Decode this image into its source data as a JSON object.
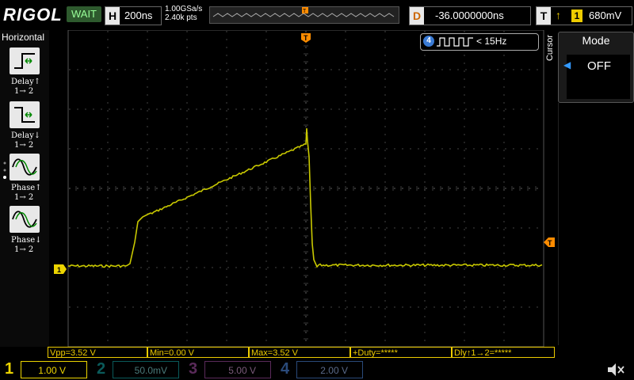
{
  "brand": "RIGOL",
  "status": "WAIT",
  "timebase": {
    "label": "H",
    "value": "200ns"
  },
  "sample": {
    "rate": "1.00GSa/s",
    "points": "2.40k pts"
  },
  "delay": {
    "label": "D",
    "value": "-36.0000000ns"
  },
  "trigger": {
    "label": "T",
    "edge": "↑",
    "source": "1",
    "level": "680mV"
  },
  "horizontal_menu": {
    "title": "Horizontal",
    "items": [
      {
        "label": "Delay↑",
        "sub": "1→ 2"
      },
      {
        "label": "Delay↓",
        "sub": "1→ 2"
      },
      {
        "label": "Phase↑",
        "sub": "1→ 2"
      },
      {
        "label": "Phase↓",
        "sub": "1→ 2"
      }
    ]
  },
  "freq_badge": {
    "channel": "4",
    "text": "< 15Hz"
  },
  "cursor_menu": {
    "tab": "Cursor",
    "title": "Mode",
    "value": "OFF"
  },
  "trigger_marker": "T",
  "ch1_marker": "1",
  "measurements": [
    {
      "text": "Vpp=3.52 V"
    },
    {
      "text": "Min=0.00 V"
    },
    {
      "text": "Max=3.52 V"
    },
    {
      "text": "+Duty=*****"
    },
    {
      "text": "Dly↑1→2=*****"
    }
  ],
  "channels": [
    {
      "num": "1",
      "scale": "1.00 V",
      "color": "#ecd400"
    },
    {
      "num": "2",
      "scale": "50.0mV",
      "color": "#00c0c0"
    },
    {
      "num": "3",
      "scale": "5.00 V",
      "color": "#d040d0"
    },
    {
      "num": "4",
      "scale": "2.00 V",
      "color": "#3a7bd5"
    }
  ],
  "colors": {
    "ch1": "#c8c800",
    "trigger": "#ff8c00",
    "grid": "#3a3a3a"
  }
}
